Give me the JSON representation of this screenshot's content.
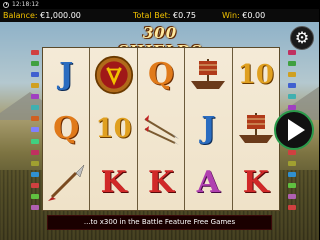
{
  "status": {
    "time": "12:18:12"
  },
  "info": {
    "balance_label": "Balance:",
    "balance_value": "€1,000.00",
    "bet_label": "Total Bet:",
    "bet_value": "€0.75",
    "win_label": "Win:",
    "win_value": "€0.00"
  },
  "game": {
    "logo": "300 SHIELDS"
  },
  "reels": [
    [
      "J",
      "Q",
      "spear-icon"
    ],
    [
      "shield-icon",
      "10",
      "K"
    ],
    [
      "Q",
      "arrows-icon",
      "K"
    ],
    [
      "ship-icon",
      "J",
      "A"
    ],
    [
      "10",
      "ship-icon",
      "K"
    ]
  ],
  "message": "...to x300 in the Battle Feature Free Games",
  "colors": {
    "accent": "#f2c200",
    "play_ring": "#2a9a4a",
    "message_bg": "#1a0000"
  },
  "icons": {
    "settings": "gear-icon",
    "spin": "play-icon",
    "clock": "clock-icon"
  }
}
